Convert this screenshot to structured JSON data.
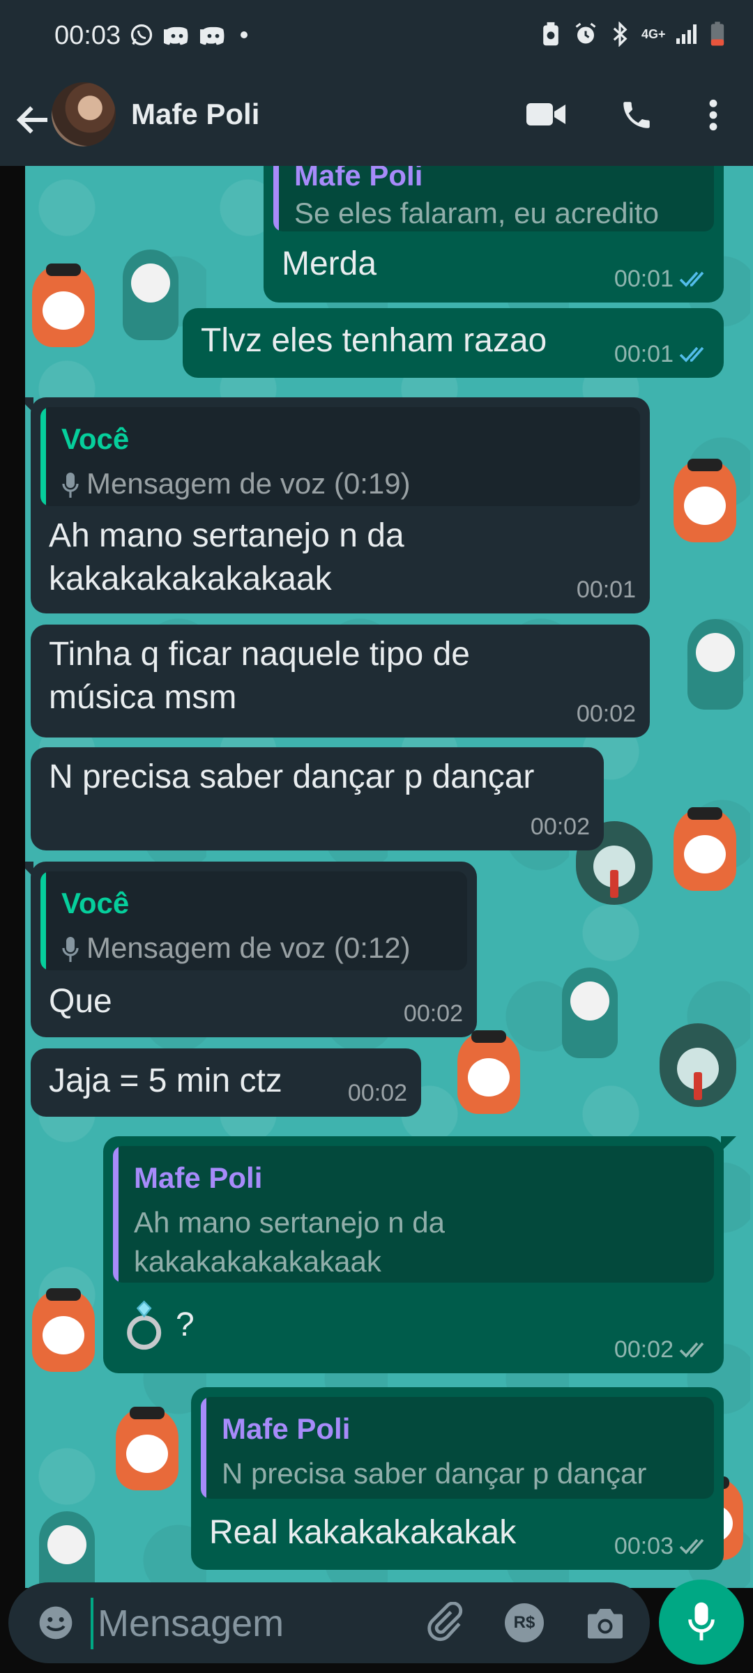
{
  "status_bar": {
    "time": "00:03",
    "left_icons": [
      "whatsapp-icon",
      "discord-icon",
      "discord-icon",
      "notification-dot"
    ],
    "right_icons": [
      "battery-saver-icon",
      "alarm-icon",
      "bluetooth-icon",
      "4g-icon",
      "signal-icon",
      "battery-icon"
    ],
    "network_label": "4G+"
  },
  "header": {
    "contact_name": "Mafe Poli",
    "actions": [
      "video-call-icon",
      "voice-call-icon",
      "more-options-icon"
    ]
  },
  "messages": [
    {
      "direction": "out",
      "quote_author": "Mafe Poli",
      "quote_text": "Se eles falaram, eu acredito",
      "text": "Merda",
      "time": "00:01",
      "status": "read"
    },
    {
      "direction": "out",
      "text": "Tlvz eles tenham razao",
      "time": "00:01",
      "status": "read"
    },
    {
      "direction": "in",
      "quote_author": "Você",
      "quote_text": "Mensagem de voz (0:19)",
      "text_lines": [
        "Ah mano sertanejo n da",
        "kakakakakakakaak"
      ],
      "time": "00:01"
    },
    {
      "direction": "in",
      "text_lines": [
        "Tinha q ficar naquele tipo de",
        "música msm"
      ],
      "time": "00:02"
    },
    {
      "direction": "in",
      "text": "N precisa saber dançar p dançar",
      "time": "00:02"
    },
    {
      "direction": "in",
      "quote_author": "Você",
      "quote_text": "Mensagem de voz (0:12)",
      "text": "Que",
      "time": "00:02"
    },
    {
      "direction": "in",
      "text": "Jaja = 5 min ctz",
      "time": "00:02"
    },
    {
      "direction": "out",
      "quote_author": "Mafe Poli",
      "quote_text_lines": [
        "Ah mano sertanejo n da",
        "kakakakakakakaak"
      ],
      "text": "?",
      "emoji": "💍",
      "time": "00:02",
      "status": "delivered"
    },
    {
      "direction": "out",
      "quote_author": "Mafe Poli",
      "quote_text": "N precisa saber dançar p dançar",
      "text": "Real kakakakakakak",
      "time": "00:03",
      "status": "delivered"
    }
  ],
  "composer": {
    "placeholder": "Mensagem",
    "icons": [
      "emoji-icon",
      "attach-icon",
      "payment-icon",
      "camera-icon"
    ],
    "payment_label": "R$",
    "send_icon": "mic-icon"
  },
  "colors": {
    "incoming_bubble": "#1f2c34",
    "outgoing_bubble": "#005c4b",
    "accent": "#00a884",
    "you_quote_name": "#06cf9c",
    "contact_quote_name": "#a78bfa",
    "read_ticks": "#53bdeb",
    "wallpaper": "#3fb3ae"
  }
}
